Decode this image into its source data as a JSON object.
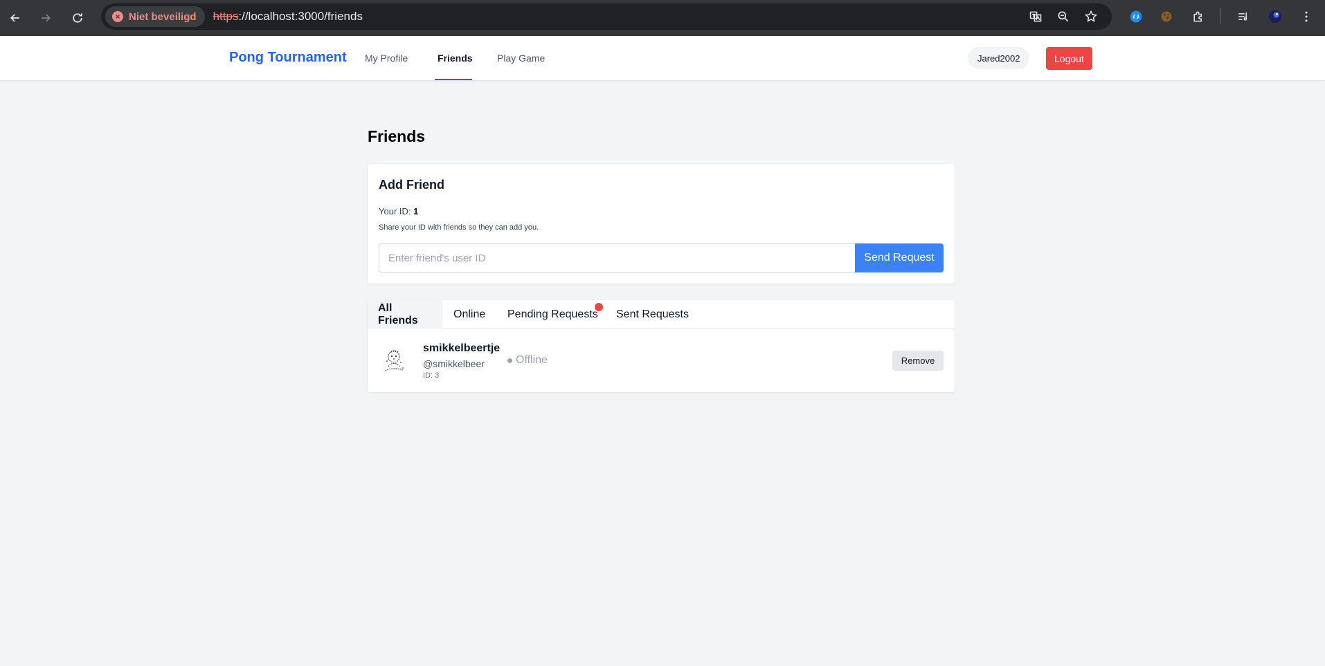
{
  "browser": {
    "security_label": "Niet beveiligd",
    "url_scheme": "https",
    "url_rest": "://localhost:3000/friends"
  },
  "header": {
    "brand": "Pong Tournament",
    "nav": [
      {
        "label": "My Profile",
        "active": false
      },
      {
        "label": "Friends",
        "active": true
      },
      {
        "label": "Play Game",
        "active": false
      }
    ],
    "username": "Jared2002",
    "logout_label": "Logout",
    "accent_color": "#2563eb"
  },
  "page": {
    "title": "Friends"
  },
  "add_friend": {
    "title": "Add Friend",
    "your_id_label": "Your ID:",
    "your_id_value": "1",
    "hint": "Share your ID with friends so they can add you.",
    "input_placeholder": "Enter friend's user ID",
    "input_value": "",
    "send_label": "Send Request"
  },
  "tabs": [
    {
      "label": "All Friends",
      "active": true
    },
    {
      "label": "Online",
      "active": false
    },
    {
      "label": "Pending Requests",
      "active": false,
      "has_notification": true
    },
    {
      "label": "Sent Requests",
      "active": false
    }
  ],
  "friends": [
    {
      "display_name": "smikkelbeertje",
      "handle": "@smikkelbeer",
      "id_text": "ID: 3",
      "status": "Offline",
      "remove_label": "Remove"
    }
  ]
}
